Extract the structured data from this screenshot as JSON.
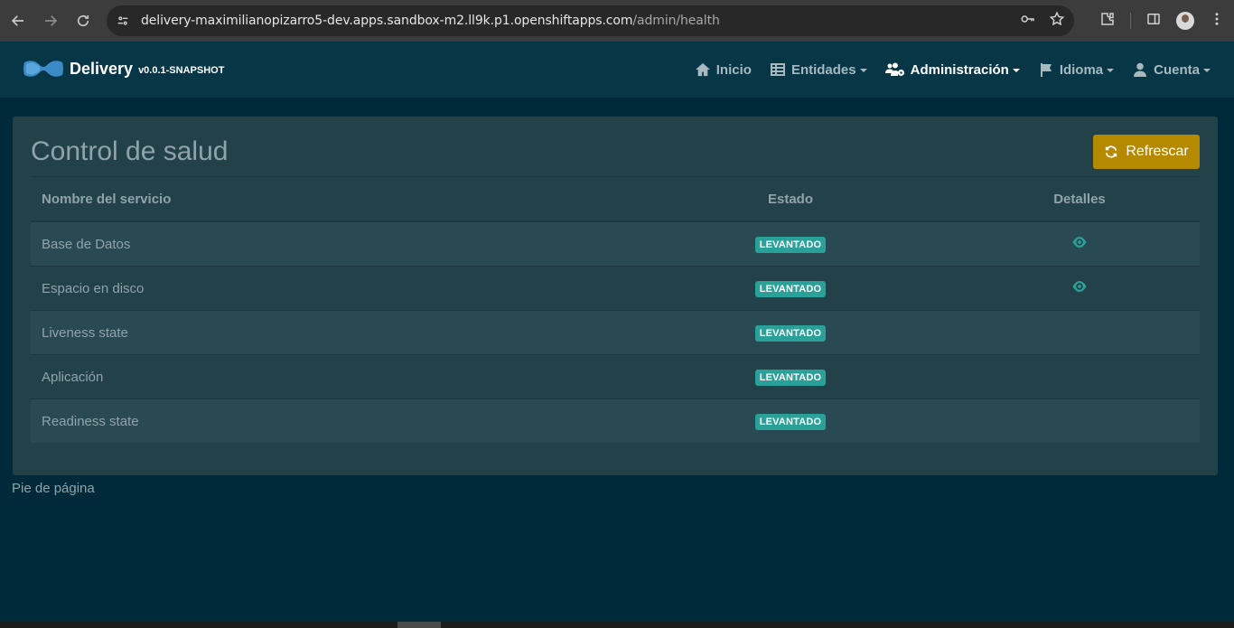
{
  "browser": {
    "url_host": "delivery-maximilianopizarro5-dev.apps.sandbox-m2.ll9k.p1.openshiftapps.com",
    "url_path": "/admin/health"
  },
  "navbar": {
    "brand": "Delivery",
    "version": "v0.0.1-SNAPSHOT",
    "items": [
      {
        "label": "Inicio",
        "icon": "home-icon"
      },
      {
        "label": "Entidades",
        "icon": "table-list-icon"
      },
      {
        "label": "Administración",
        "icon": "users-cog-icon"
      },
      {
        "label": "Idioma",
        "icon": "flag-icon"
      },
      {
        "label": "Cuenta",
        "icon": "user-icon"
      }
    ]
  },
  "page": {
    "title": "Control de salud",
    "refresh_label": "Refrescar"
  },
  "table": {
    "headers": [
      "Nombre del servicio",
      "Estado",
      "Detalles"
    ],
    "rows": [
      {
        "name": "Base de Datos",
        "status": "LEVANTADO",
        "details": true
      },
      {
        "name": "Espacio en disco",
        "status": "LEVANTADO",
        "details": true
      },
      {
        "name": "Liveness state",
        "status": "LEVANTADO",
        "details": false
      },
      {
        "name": "Aplicación",
        "status": "LEVANTADO",
        "details": false
      },
      {
        "name": "Readiness state",
        "status": "LEVANTADO",
        "details": false
      }
    ]
  },
  "footer": {
    "text": "Pie de página"
  },
  "colors": {
    "status_up": "#2aa198",
    "accent": "#b58900",
    "background": "#00293a"
  }
}
